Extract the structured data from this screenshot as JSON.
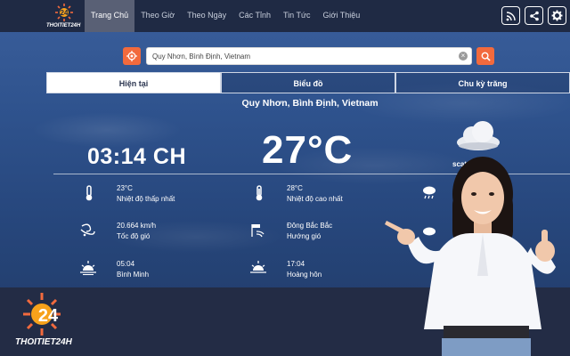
{
  "header": {
    "logo_text": "THOITIET24H",
    "nav": [
      "Trang Chủ",
      "Theo Giờ",
      "Theo Ngày",
      "Các Tỉnh",
      "Tin Tức",
      "Giới Thiệu"
    ],
    "active_index": 0,
    "icons": [
      "rss-icon",
      "share-icon",
      "gear-icon"
    ]
  },
  "search": {
    "value": "Quy Nhơn, Bình Định, Vietnam",
    "clear_label": "×"
  },
  "tabs": [
    "Hiện tại",
    "Biểu đồ",
    "Chu kỳ trăng"
  ],
  "weather": {
    "location": "Quy Nhơn, Bình Định, Vietnam",
    "time": "03:14 CH",
    "temperature": "27°C",
    "condition": "scatt",
    "stats": {
      "min_temp_value": "23°C",
      "min_temp_label": "Nhiệt độ thấp nhất",
      "max_temp_value": "28°C",
      "max_temp_label": "Nhiệt độ cao nhất",
      "wind_speed_value": "20.664 km/h",
      "wind_speed_label": "Tốc độ gió",
      "wind_dir_value": "Đông Bắc Bắc",
      "wind_dir_label": "Hướng gió",
      "sunrise_value": "05:04",
      "sunrise_label": "Bình Minh",
      "sunset_value": "17:04",
      "sunset_label": "Hoàng hôn"
    }
  },
  "footer": {
    "logo_text": "THOITIET24H"
  },
  "colors": {
    "accent": "#f26a3d",
    "nav_bg": "#1f2a44",
    "footer_bg": "#232c45"
  }
}
